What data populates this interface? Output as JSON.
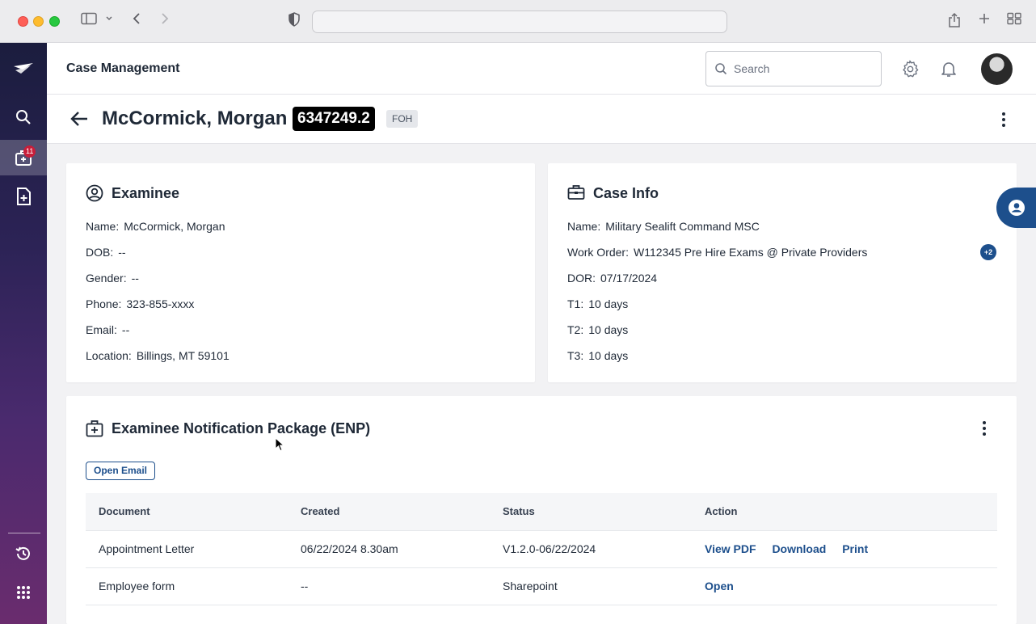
{
  "browser": {
    "url": ""
  },
  "nav": {
    "badge_count": "11"
  },
  "header": {
    "app_title": "Case Management",
    "search_placeholder": "Search"
  },
  "case_header": {
    "name": "McCormick, Morgan",
    "case_id": "6347249.2",
    "tag": "FOH"
  },
  "examinee": {
    "title": "Examinee",
    "fields": [
      {
        "label": "Name:",
        "value": "McCormick, Morgan"
      },
      {
        "label": "DOB:",
        "value": "--"
      },
      {
        "label": "Gender:",
        "value": "--"
      },
      {
        "label": "Phone:",
        "value": "323-855-xxxx"
      },
      {
        "label": "Email:",
        "value": "--"
      },
      {
        "label": "Location:",
        "value": "Billings, MT 59101"
      }
    ]
  },
  "case_info": {
    "title": "Case Info",
    "fields": [
      {
        "label": "Name:",
        "value": "Military Sealift Command MSC"
      },
      {
        "label": "Work Order:",
        "value": "W112345 Pre Hire Exams @ Private Providers"
      },
      {
        "label": "DOR:",
        "value": "07/17/2024"
      },
      {
        "label": "T1:",
        "value": "10 days"
      },
      {
        "label": "T2:",
        "value": "10 days"
      },
      {
        "label": "T3:",
        "value": "10 days"
      }
    ],
    "more_badge": "+2"
  },
  "enp": {
    "title": "Examinee Notification Package (ENP)",
    "open_email_label": "Open Email",
    "columns": [
      "Document",
      "Created",
      "Status",
      "Action"
    ],
    "rows": [
      {
        "document": "Appointment Letter",
        "created": "06/22/2024 8.30am",
        "status": "V1.2.0-06/22/2024",
        "actions": [
          "View PDF",
          "Download",
          "Print"
        ]
      },
      {
        "document": "Employee form",
        "created": "--",
        "status": "Sharepoint",
        "actions": [
          "Open"
        ]
      }
    ]
  },
  "colors": {
    "accent": "#1d4f8c",
    "badge": "#c81e3a"
  }
}
